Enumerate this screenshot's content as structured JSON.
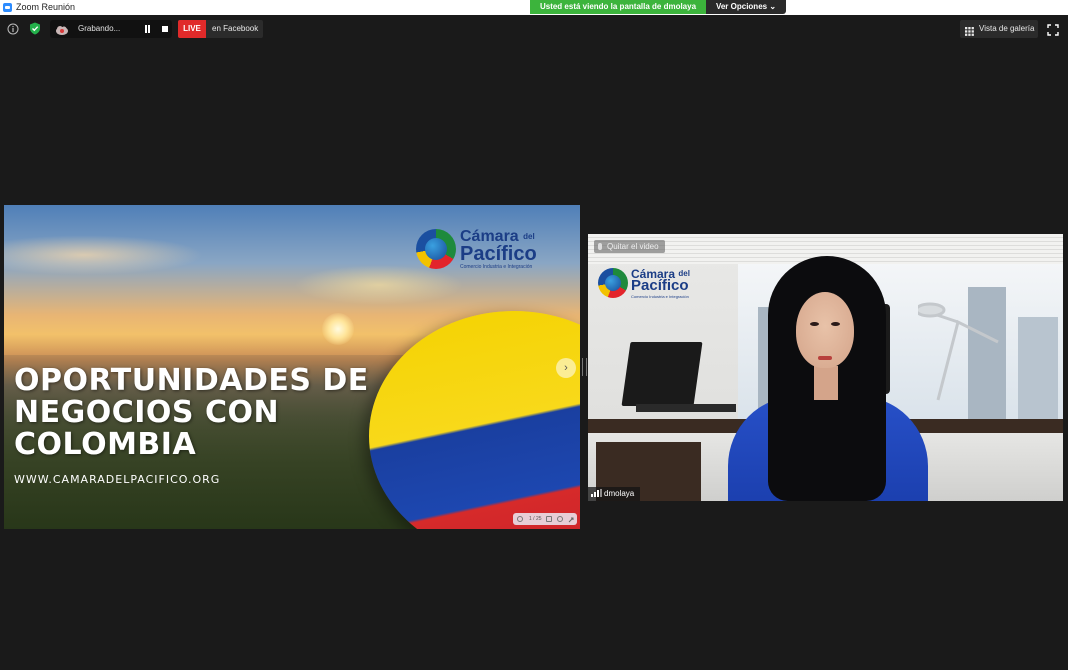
{
  "window": {
    "title": "Zoom Reunión"
  },
  "share_banner": {
    "text": "Usted está viendo la pantalla de dmolaya",
    "options_label": "Ver Opciones"
  },
  "toolbar": {
    "info_icon": "info-icon",
    "security_icon": "shield-check-icon",
    "recording_label": "Grabando...",
    "live_badge": "LIVE",
    "live_destination": "en Facebook",
    "gallery_label": "Vista de galería"
  },
  "shared_screen": {
    "headline": [
      "OPORTUNIDADES DE",
      "NEGOCIOS CON",
      "COLOMBIA"
    ],
    "url": "WWW.CAMARADELPACIFICO.ORG",
    "logo": {
      "line1": "Cámara",
      "line1_small": "del",
      "line2": "Pacífico",
      "tagline": "Comercio Industria e Integración"
    },
    "page_indicator": "1 / 25",
    "next_arrow": "›",
    "colors": {
      "flag_yellow": "#f4d200",
      "flag_blue": "#1a3fa0",
      "flag_red": "#d62a2a"
    }
  },
  "participant_video": {
    "name": "dmolaya",
    "hover_hint": "Quitar el video",
    "logo": {
      "line1": "Cámara",
      "line1_small": "del",
      "line2": "Pacífico",
      "tagline": "Comercio Industria e Integración"
    }
  },
  "colors": {
    "live_red": "#e02a2a",
    "banner_green": "#3cb43c",
    "background": "#1a1a1a"
  }
}
